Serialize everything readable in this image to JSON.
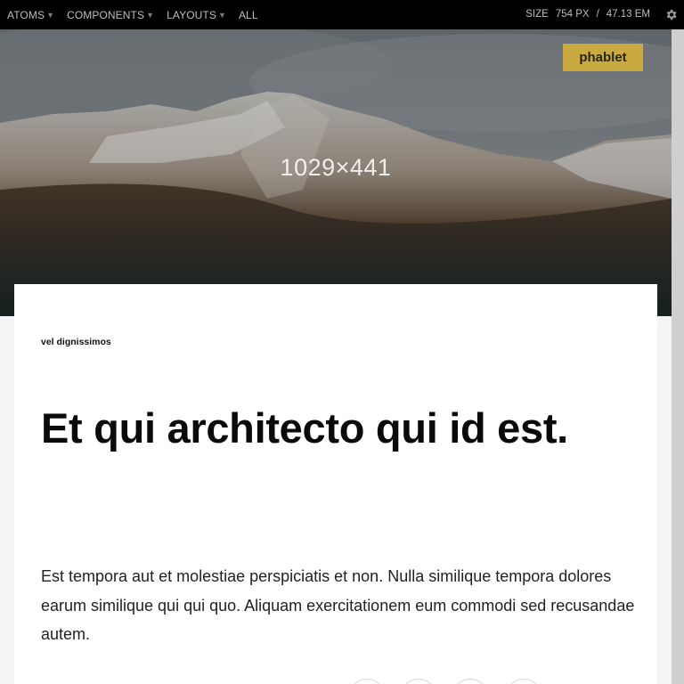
{
  "toolbar": {
    "nav": [
      {
        "label": "ATOMS",
        "has_caret": true
      },
      {
        "label": "COMPONENTS",
        "has_caret": true
      },
      {
        "label": "LAYOUTS",
        "has_caret": true
      },
      {
        "label": "ALL",
        "has_caret": false
      }
    ],
    "size_label": "SIZE",
    "size_px": "754 PX",
    "separator": "/",
    "size_em": "47.13 EM",
    "settings_icon": "gear-icon"
  },
  "hero": {
    "dimensions_label": "1029×441",
    "breakpoint_badge": "phablet"
  },
  "article": {
    "eyebrow": "vel dignissimos",
    "headline": "Et qui architecto qui id est.",
    "body": "Est tempora aut et molestiae perspiciatis et non. Nulla similique tempora dolores earum similique qui qui quo. Aliquam exercitationem eum commodi sed recusandae autem."
  },
  "colors": {
    "toolbar_bg": "#000000",
    "badge_bg": "#c9aa41",
    "page_bg": "#f4f4f4",
    "card_bg": "#ffffff"
  }
}
